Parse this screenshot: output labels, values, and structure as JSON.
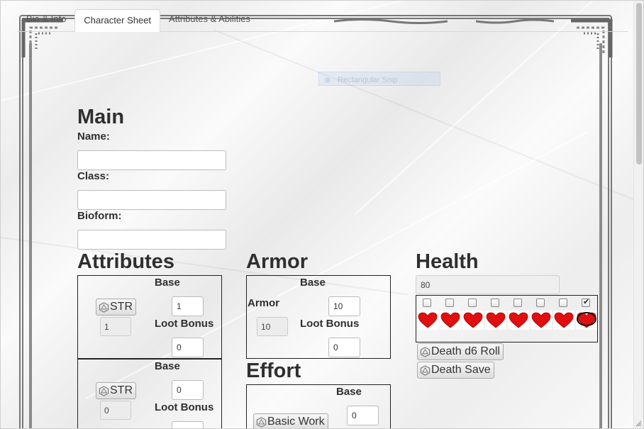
{
  "tabs": [
    "Bio & Info",
    "Character Sheet",
    "Attributes & Abilities"
  ],
  "active_tab": 1,
  "overlay": {
    "label": "Rectangular Snip"
  },
  "main": {
    "heading": "Main",
    "name_label": "Name:",
    "class_label": "Class:",
    "bioform_label": "Bioform:",
    "name_value": "",
    "class_value": "",
    "bioform_value": ""
  },
  "attributes": {
    "heading": "Attributes",
    "rows": [
      {
        "roll_label": "STR",
        "base_label": "Base",
        "base_value": "1",
        "total": "1",
        "loot_label": "Loot Bonus",
        "loot_value": "0"
      },
      {
        "roll_label": "STR",
        "base_label": "Base",
        "base_value": "0",
        "total": "0",
        "loot_label": "Loot Bonus",
        "loot_value": ""
      }
    ]
  },
  "armor": {
    "heading": "Armor",
    "base_label": "Base",
    "armor_label": "Armor",
    "base_value": "10",
    "total": "10",
    "loot_label": "Loot Bonus",
    "loot_value": "0"
  },
  "effort": {
    "heading": "Effort",
    "base_label": "Base",
    "roll_label": "Basic Work",
    "base_value": "0"
  },
  "health": {
    "heading": "Health",
    "value": "80",
    "hearts": [
      false,
      false,
      false,
      false,
      false,
      false,
      false,
      true
    ],
    "heart_color": "#e01010",
    "buttons": {
      "death_roll": "Death d6 Roll",
      "death_save": "Death Save"
    }
  }
}
